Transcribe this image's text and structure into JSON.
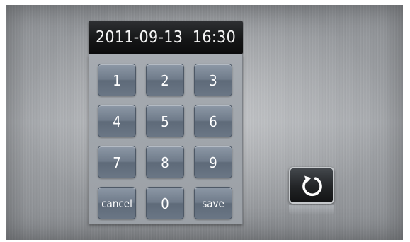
{
  "datetime_display": "2011-09-13  16:30",
  "keypad": {
    "keys": [
      "1",
      "2",
      "3",
      "4",
      "5",
      "6",
      "7",
      "8",
      "9",
      "cancel",
      "0",
      "save"
    ]
  },
  "refresh_button": {
    "icon": "refresh-icon"
  }
}
